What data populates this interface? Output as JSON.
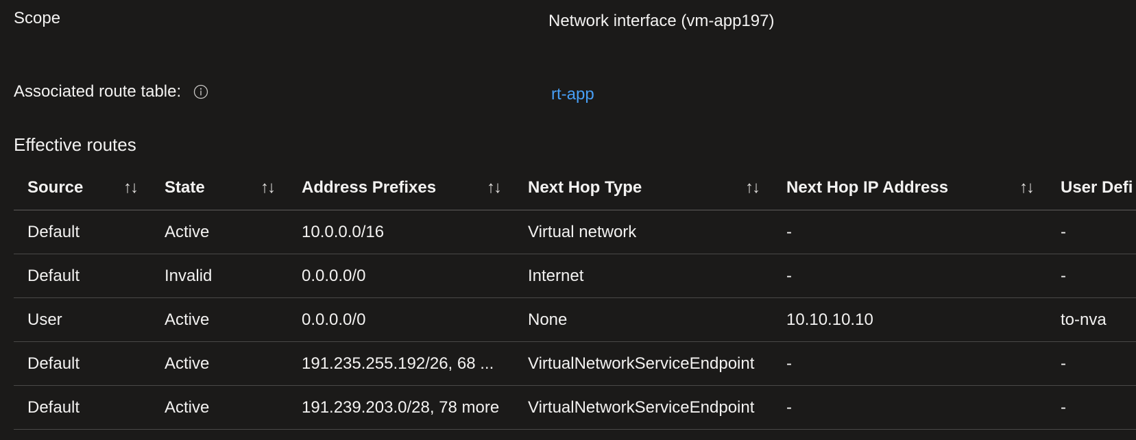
{
  "scope": {
    "label": "Scope",
    "value": "Network interface (vm-app197)"
  },
  "associated_route_table": {
    "label": "Associated route table:",
    "info_icon": "info-icon",
    "link": "rt-app"
  },
  "effective_routes": {
    "title": "Effective routes",
    "sort_icon": "↑↓",
    "columns": [
      "Source",
      "State",
      "Address Prefixes",
      "Next Hop Type",
      "Next Hop IP Address",
      "User Defi"
    ],
    "rows": [
      [
        "Default",
        "Active",
        "10.0.0.0/16",
        "Virtual network",
        "-",
        "-"
      ],
      [
        "Default",
        "Invalid",
        "0.0.0.0/0",
        "Internet",
        "-",
        "-"
      ],
      [
        "User",
        "Active",
        "0.0.0.0/0",
        "None",
        "10.10.10.10",
        "to-nva"
      ],
      [
        "Default",
        "Active",
        "191.235.255.192/26, 68 ...",
        "VirtualNetworkServiceEndpoint",
        "-",
        "-"
      ],
      [
        "Default",
        "Active",
        "191.239.203.0/28, 78 more",
        "VirtualNetworkServiceEndpoint",
        "-",
        "-"
      ]
    ]
  },
  "colors": {
    "background": "#1b1a19",
    "text": "#f3f2f1",
    "link": "#479ef5",
    "divider": "#4a4948"
  }
}
